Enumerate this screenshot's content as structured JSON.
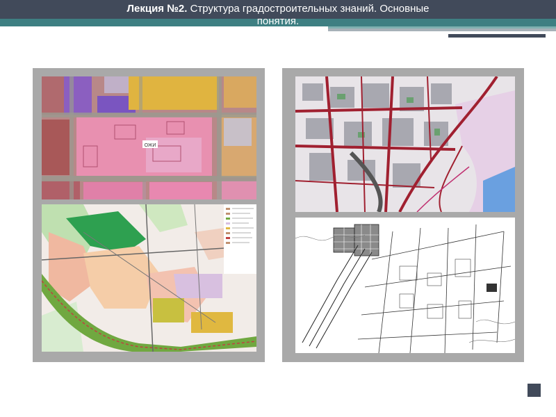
{
  "slide": {
    "title_bold": "Лекция №2.",
    "title_rest": " Структура градостроительных знаний. Основные",
    "title_line2": "понятия."
  },
  "maps": {
    "map1_label": "ОЖИ"
  },
  "colors": {
    "header_dark": "#414a5a",
    "header_teal": "#3e7f82",
    "panel_frame": "#a9a9a9"
  }
}
